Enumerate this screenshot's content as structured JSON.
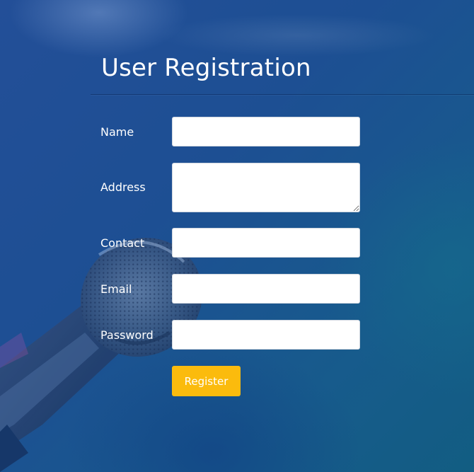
{
  "form": {
    "title": "User Registration",
    "fields": {
      "name": {
        "label": "Name",
        "value": ""
      },
      "address": {
        "label": "Address",
        "value": ""
      },
      "contact": {
        "label": "Contact",
        "value": ""
      },
      "email": {
        "label": "Email",
        "value": ""
      },
      "password": {
        "label": "Password",
        "value": ""
      }
    },
    "submit_label": "Register"
  },
  "colors": {
    "background": "#1d4f93",
    "button": "#fbbb0d",
    "text": "#ffffff"
  },
  "background_image": "microphone-image"
}
